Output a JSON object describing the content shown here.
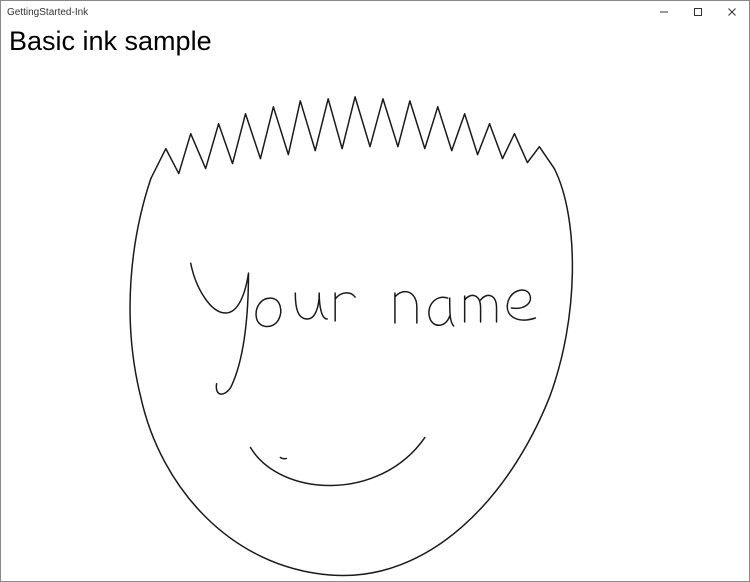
{
  "window": {
    "title": "GettingStarted-Ink",
    "controls": {
      "minimize_icon": "minimize-icon",
      "maximize_icon": "maximize-icon",
      "close_icon": "close-icon"
    }
  },
  "content": {
    "heading": "Basic ink sample",
    "ink": {
      "strokes_description": "hand-drawn-face-with-spiky-hair-and-cursive-your-name",
      "strokes_semantic": "Your name",
      "stroke_color": "#1a1a1a"
    }
  }
}
